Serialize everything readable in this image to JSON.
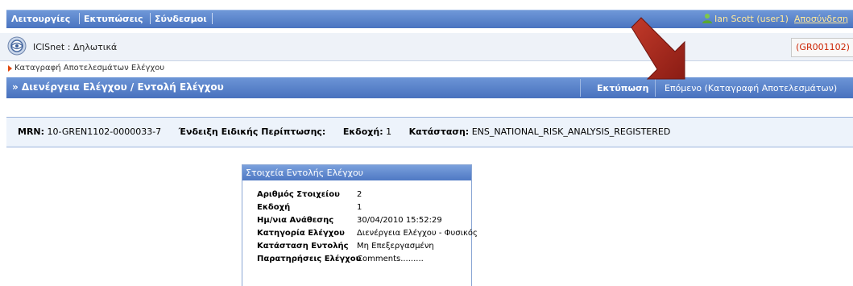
{
  "menu": {
    "items": [
      "Λειτουργίες",
      "Εκτυπώσεις",
      "Σύνδεσμοι"
    ],
    "user": "Ian Scott (user1)",
    "logout": "Αποσύνδεση"
  },
  "app": {
    "title": "ICISnet : Δηλωτικά",
    "ref": "(GR001102)"
  },
  "breadcrumb": "Καταγραφή Αποτελεσμάτων Ελέγχου",
  "titlebar": {
    "title": "» Διενέργεια Ελέγχου / Εντολή Ελέγχου",
    "print": "Εκτύπωση",
    "next": "Επόμενο (Καταγραφή Αποτελεσμάτων)"
  },
  "status": {
    "mrn_label": "MRN:",
    "mrn": "10-GREN1102-0000033-7",
    "special_label": "Ένδειξη Ειδικής Περίπτωσης:",
    "special": "",
    "version_label": "Εκδοχή:",
    "version": "1",
    "state_label": "Κατάσταση:",
    "state": "ENS_NATIONAL_RISK_ANALYSIS_REGISTERED"
  },
  "panel": {
    "title": "Στοιχεία Εντολής Ελέγχου",
    "rows": [
      {
        "label": "Αριθμός Στοιχείου",
        "value": "2"
      },
      {
        "label": "Εκδοχή",
        "value": "1"
      },
      {
        "label": "Ημ/νια Ανάθεσης",
        "value": "30/04/2010 15:52:29"
      },
      {
        "label": "Κατηγορία Ελέγχου",
        "value": "Διενέργεια Ελέγχου - Φυσικός"
      },
      {
        "label": "Κατάσταση Εντολής",
        "value": "Μη Επεξεργασμένη"
      },
      {
        "label": "Παρατηρήσεις Ελέγχου",
        "value": "Comments........."
      }
    ]
  },
  "icons": {
    "user": "user-icon",
    "logo": "globe-logo-icon",
    "breadcrumb": "arrow-right-icon",
    "annotation": "red-arrow-icon"
  },
  "colors": {
    "menubar": "#5a82c8",
    "user_text": "#ffe89a",
    "ref_text": "#cc2200",
    "annotation_arrow": "#a5251b"
  }
}
